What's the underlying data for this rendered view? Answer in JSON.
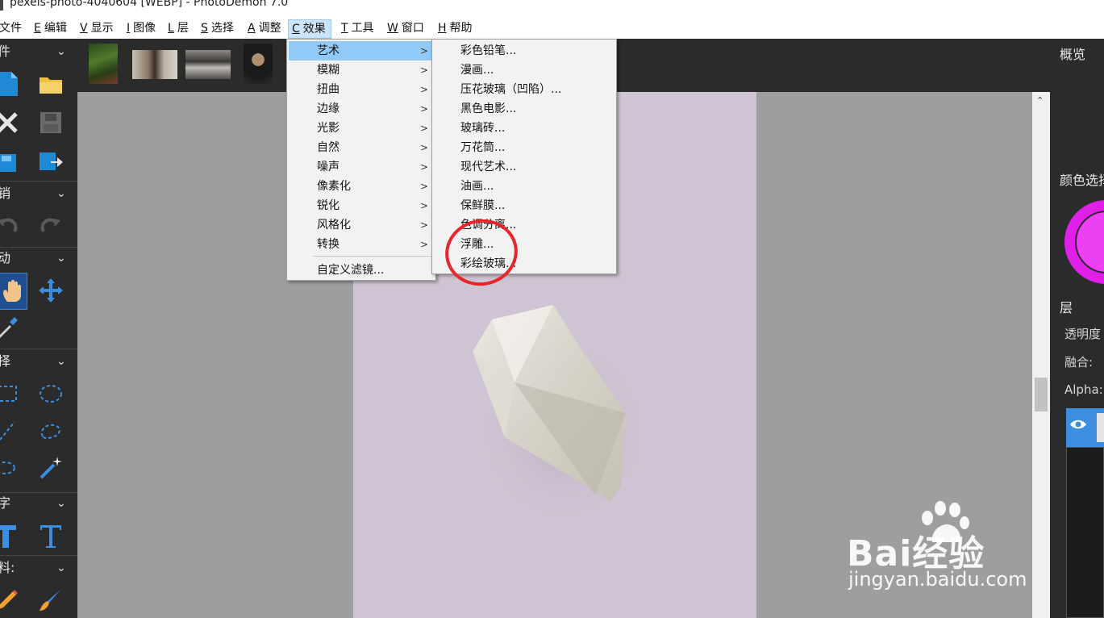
{
  "window": {
    "title": "pexels-photo-4040604 [WEBP]  -  PhotoDemon 7.0"
  },
  "menubar": [
    {
      "key": "",
      "label": "文件",
      "name": "menu-file"
    },
    {
      "key": "E",
      "label": "编辑",
      "name": "menu-edit"
    },
    {
      "key": "V",
      "label": "显示",
      "name": "menu-view"
    },
    {
      "key": "I",
      "label": "图像",
      "name": "menu-image"
    },
    {
      "key": "L",
      "label": "层",
      "name": "menu-layer"
    },
    {
      "key": "S",
      "label": "选择",
      "name": "menu-select"
    },
    {
      "key": "A",
      "label": "调整",
      "name": "menu-adjust"
    },
    {
      "key": "C",
      "label": "效果",
      "name": "menu-effects"
    },
    {
      "key": "T",
      "label": "工具",
      "name": "menu-tools"
    },
    {
      "key": "W",
      "label": "窗口",
      "name": "menu-window"
    },
    {
      "key": "H",
      "label": "帮助",
      "name": "menu-help"
    }
  ],
  "left_panel": {
    "sections": [
      "件",
      "销",
      "动",
      "择",
      "字",
      "料:"
    ]
  },
  "effects_menu": {
    "items": [
      "艺术",
      "模糊",
      "扭曲",
      "边缘",
      "光影",
      "自然",
      "噪声",
      "像素化",
      "锐化",
      "风格化",
      "转换"
    ],
    "custom_filter": "自定义滤镜..."
  },
  "artistic_submenu": {
    "items": [
      "彩色铅笔...",
      "漫画...",
      "压花玻璃（凹陷）...",
      "黑色电影...",
      "玻璃砖...",
      "万花筒...",
      "现代艺术...",
      "油画...",
      "保鲜膜...",
      "色调分离...",
      "浮雕...",
      "彩绘玻璃..."
    ]
  },
  "right_panel": {
    "overview": "概览",
    "color_selector": "颜色选择",
    "layers": "层",
    "opacity": "透明度",
    "blend": "融合:",
    "alpha": "Alpha:"
  },
  "watermark": {
    "brand": "Bai经验",
    "url": "jingyan.baidu.com"
  },
  "colors": {
    "menu_highlight": "#91c9f7",
    "panel_bg": "#2b2b2b",
    "canvas_bg": "#9e9e9e",
    "annotation": "#e8252a",
    "accent": "#3b8ee0"
  }
}
